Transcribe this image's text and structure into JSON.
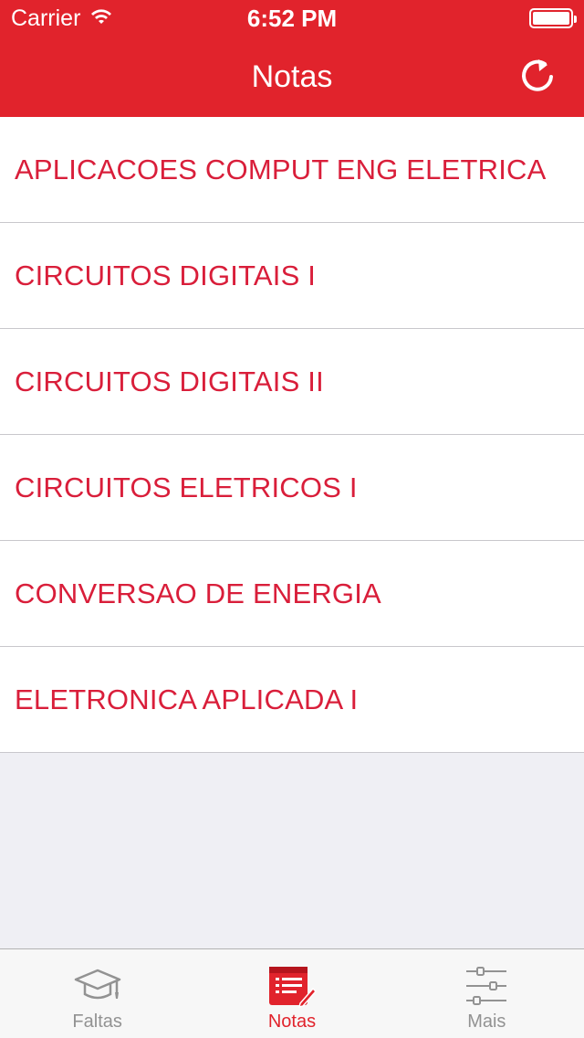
{
  "status_bar": {
    "carrier": "Carrier",
    "time": "6:52 PM"
  },
  "nav": {
    "title": "Notas"
  },
  "subjects": [
    "APLICACOES COMPUT ENG ELETRICA",
    "CIRCUITOS DIGITAIS I",
    "CIRCUITOS DIGITAIS II",
    "CIRCUITOS ELETRICOS I",
    "CONVERSAO DE ENERGIA",
    "ELETRONICA APLICADA I"
  ],
  "tabs": [
    {
      "label": "Faltas",
      "icon": "graduation-cap-icon",
      "active": false
    },
    {
      "label": "Notas",
      "icon": "notes-pencil-icon",
      "active": true
    },
    {
      "label": "Mais",
      "icon": "sliders-icon",
      "active": false
    }
  ],
  "colors": {
    "brand": "#e1232c",
    "row_text": "#d91e3a",
    "inactive_tab": "#929292"
  }
}
